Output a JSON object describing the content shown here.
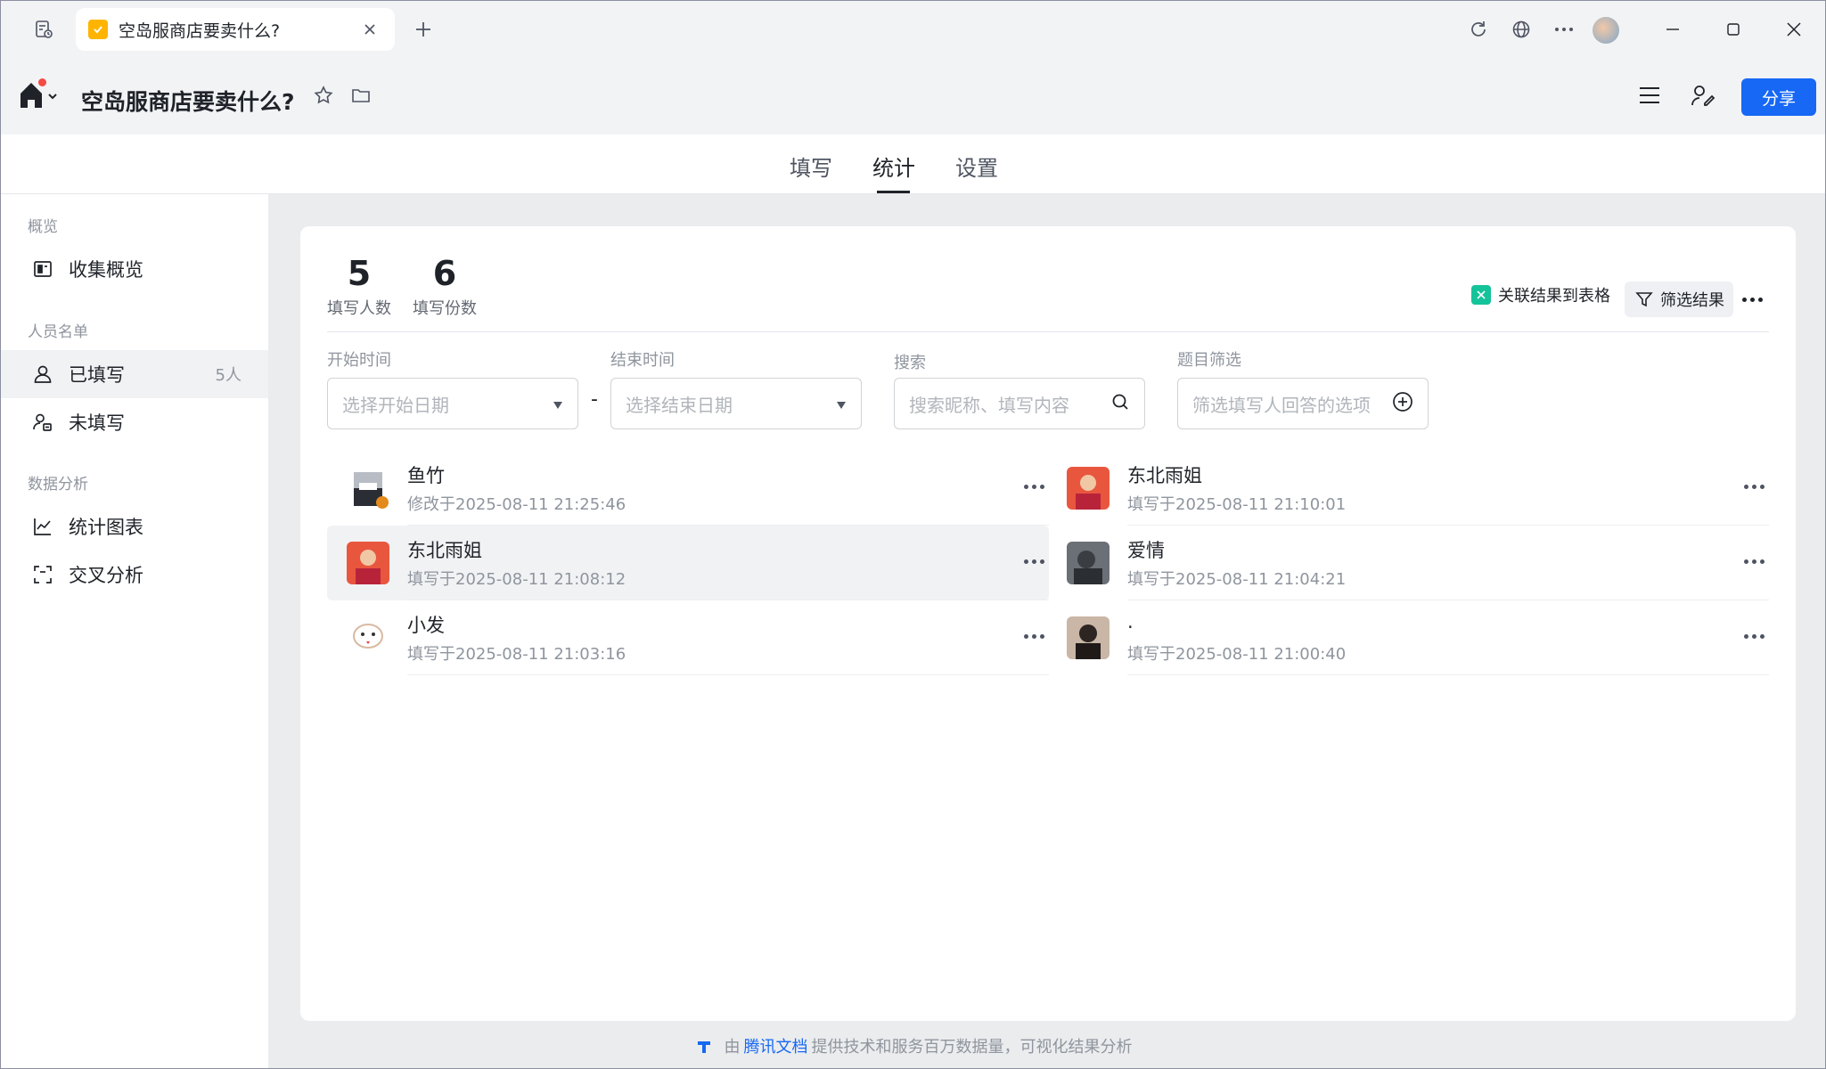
{
  "browser": {
    "tab_title": "空岛服商店要卖什么?"
  },
  "header": {
    "title": "空岛服商店要卖什么?",
    "share_label": "分享"
  },
  "subnav": {
    "tabs": [
      {
        "label": "填写"
      },
      {
        "label": "统计"
      },
      {
        "label": "设置"
      }
    ],
    "active": "统计"
  },
  "sidebar": {
    "groups": {
      "overview": "概览",
      "people": "人员名单",
      "analysis": "数据分析"
    },
    "items": {
      "collect_overview": "收集概览",
      "filled": "已填写",
      "filled_count": "5人",
      "unfilled": "未填写",
      "stats_chart": "统计图表",
      "cross_analysis": "交叉分析"
    }
  },
  "stats": {
    "people_count": "5",
    "people_label": "填写人数",
    "submission_count": "6",
    "submission_label": "填写份数"
  },
  "actions": {
    "link_sheet": "关联结果到表格",
    "filter": "筛选结果"
  },
  "filters": {
    "start_label": "开始时间",
    "start_placeholder": "选择开始日期",
    "dash": "-",
    "end_label": "结束时间",
    "end_placeholder": "选择结束日期",
    "search_label": "搜索",
    "search_placeholder": "搜索昵称、填写内容",
    "question_label": "题目筛选",
    "question_placeholder": "筛选填写人回答的选项"
  },
  "responses": [
    {
      "name": "鱼竹",
      "time": "修改于2025-08-11 21:25:46"
    },
    {
      "name": "东北雨姐",
      "time": "填写于2025-08-11 21:10:01"
    },
    {
      "name": "东北雨姐",
      "time": "填写于2025-08-11 21:08:12"
    },
    {
      "name": "爱情",
      "time": "填写于2025-08-11 21:04:21"
    },
    {
      "name": "小发",
      "time": "填写于2025-08-11 21:03:16"
    },
    {
      "name": ".",
      "time": "填写于2025-08-11 21:00:40"
    }
  ],
  "footer": {
    "prefix": "由",
    "brand": "腾讯文档",
    "suffix": "提供技术和服务百万数据量，可视化结果分析"
  },
  "colors": {
    "accent": "#1668f5",
    "sheet_green": "#14c39a",
    "notification_red": "#f54a45"
  }
}
